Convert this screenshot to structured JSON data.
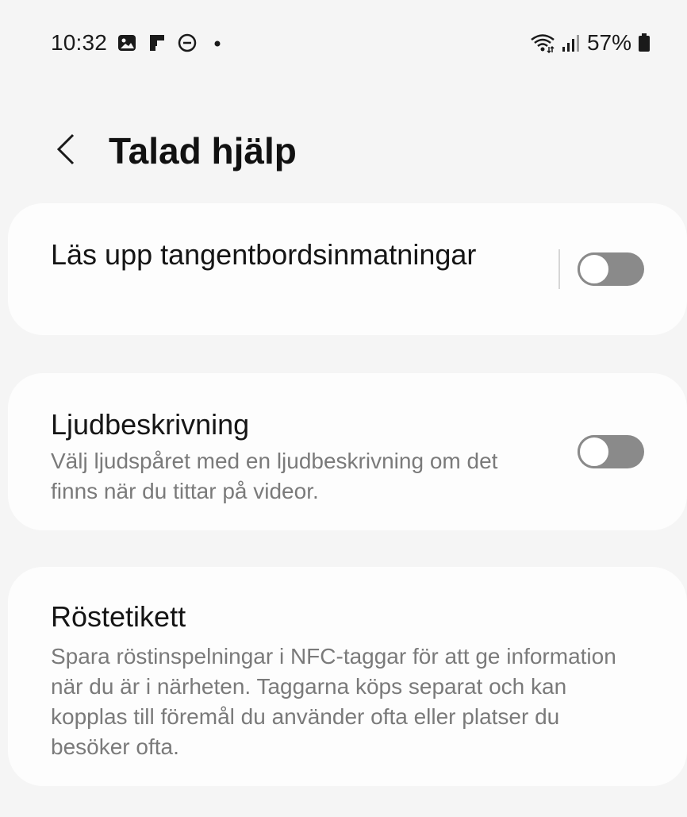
{
  "status_bar": {
    "time": "10:32",
    "left_icons": [
      "gallery-icon",
      "flipboard-icon",
      "do-not-disturb-icon",
      "dot-icon"
    ],
    "right_icons": [
      "wifi-icon",
      "signal-icon",
      "battery-icon"
    ],
    "battery_percent": "57%"
  },
  "header": {
    "back_icon": "chevron-left-icon",
    "title": "Talad hjälp"
  },
  "settings": [
    {
      "title": "Läs upp tangentbordsinmatningar",
      "description": "",
      "toggle_on": false
    },
    {
      "title": "Ljudbeskrivning",
      "description": "Välj ljudspåret med en ljudbeskrivning om det finns när du tittar på videor.",
      "toggle_on": false
    },
    {
      "title": "Röstetikett",
      "description": "Spara röstinspelningar i NFC-taggar för att ge information när du är i närheten. Taggarna köps separat och kan kopplas till föremål du använder ofta eller platser du besöker ofta."
    }
  ],
  "colors": {
    "background": "#f5f5f5",
    "card": "#fdfdfd",
    "toggle_off": "#8a8a8a",
    "secondary_text": "#7a7a7a"
  }
}
